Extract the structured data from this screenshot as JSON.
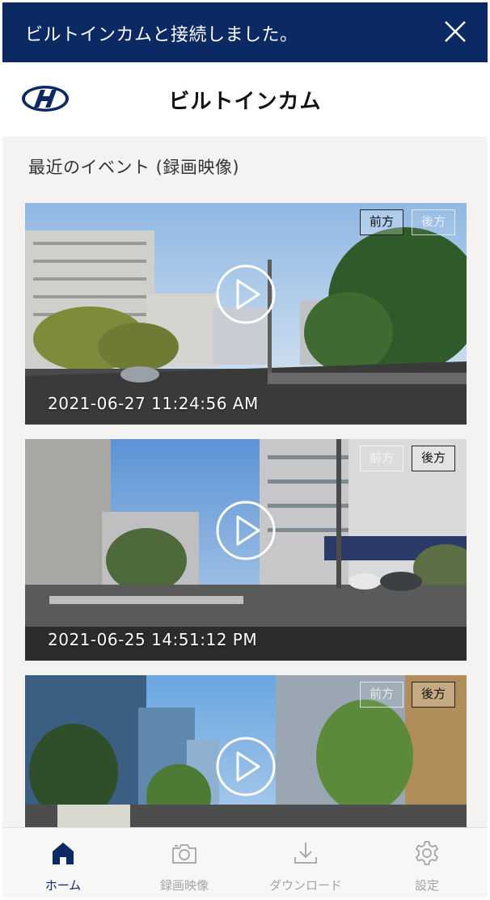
{
  "toast": {
    "message": "ビルトインカムと接続しました。",
    "close_icon": "close-icon"
  },
  "appbar": {
    "logo": "hyundai-logo",
    "title": "ビルトインカム"
  },
  "section": {
    "title": "最近のイベント (録画映像)"
  },
  "videos": [
    {
      "timestamp": "2021-06-27 11:24:56 AM",
      "front_label": "前方",
      "rear_label": "後方",
      "active_camera": "front"
    },
    {
      "timestamp": "2021-06-25 14:51:12 PM",
      "front_label": "前方",
      "rear_label": "後方",
      "active_camera": "both"
    },
    {
      "timestamp": "",
      "front_label": "前方",
      "rear_label": "後方",
      "active_camera": "rear"
    }
  ],
  "nav": {
    "items": [
      {
        "label": "ホーム",
        "icon": "home-icon",
        "active": true
      },
      {
        "label": "録画映像",
        "icon": "camera-icon",
        "active": false
      },
      {
        "label": "ダウンロード",
        "icon": "download-icon",
        "active": false
      },
      {
        "label": "設定",
        "icon": "gear-icon",
        "active": false
      }
    ]
  },
  "colors": {
    "brand_navy": "#0b2a63",
    "inactive_gray": "#a3a3a3"
  }
}
